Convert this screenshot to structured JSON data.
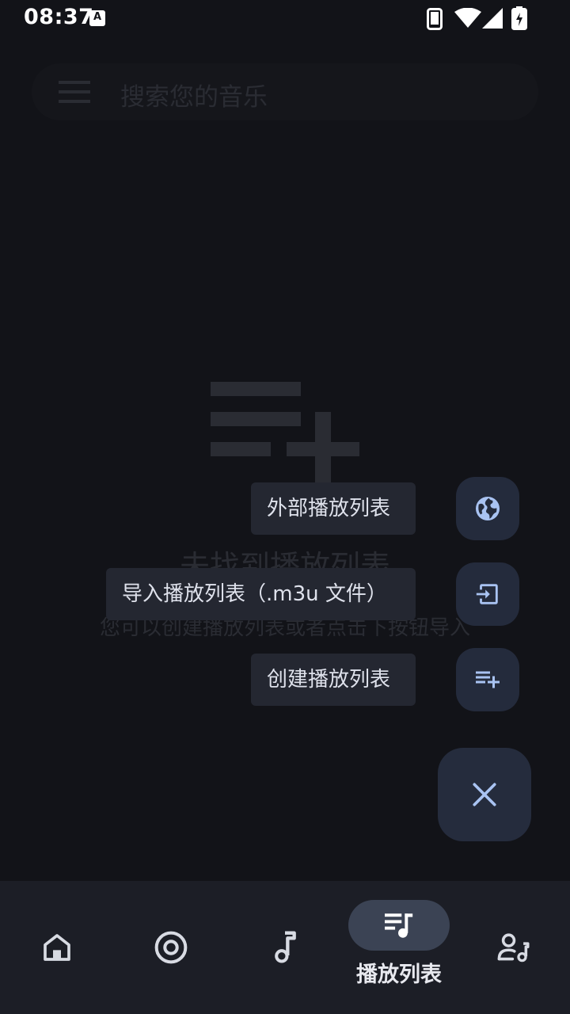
{
  "status_bar": {
    "time": "08:37",
    "notification_icon_letter": "A"
  },
  "search": {
    "placeholder": "搜索您的音乐"
  },
  "empty_state": {
    "title": "未找到播放列表",
    "description": "您可以创建播放列表或者点击下按钮导入"
  },
  "speed_dial": {
    "items": [
      {
        "label": "外部播放列表",
        "icon": "globe-icon"
      },
      {
        "label": "导入播放列表（.m3u 文件）",
        "icon": "import-icon"
      },
      {
        "label": "创建播放列表",
        "icon": "playlist-add-icon"
      }
    ],
    "close_icon": "close-icon"
  },
  "bottom_nav": {
    "items": [
      {
        "icon": "home-icon",
        "label": ""
      },
      {
        "icon": "album-icon",
        "label": ""
      },
      {
        "icon": "music-note-icon",
        "label": ""
      },
      {
        "icon": "playlist-music-icon",
        "label": "播放列表",
        "selected": true
      },
      {
        "icon": "artist-icon",
        "label": ""
      }
    ]
  },
  "colors": {
    "background": "#121318",
    "fab": "#252c3d",
    "accent_icon": "#a9c3f2",
    "nav_background": "#1c1e26",
    "nav_pill": "#3b4354"
  }
}
